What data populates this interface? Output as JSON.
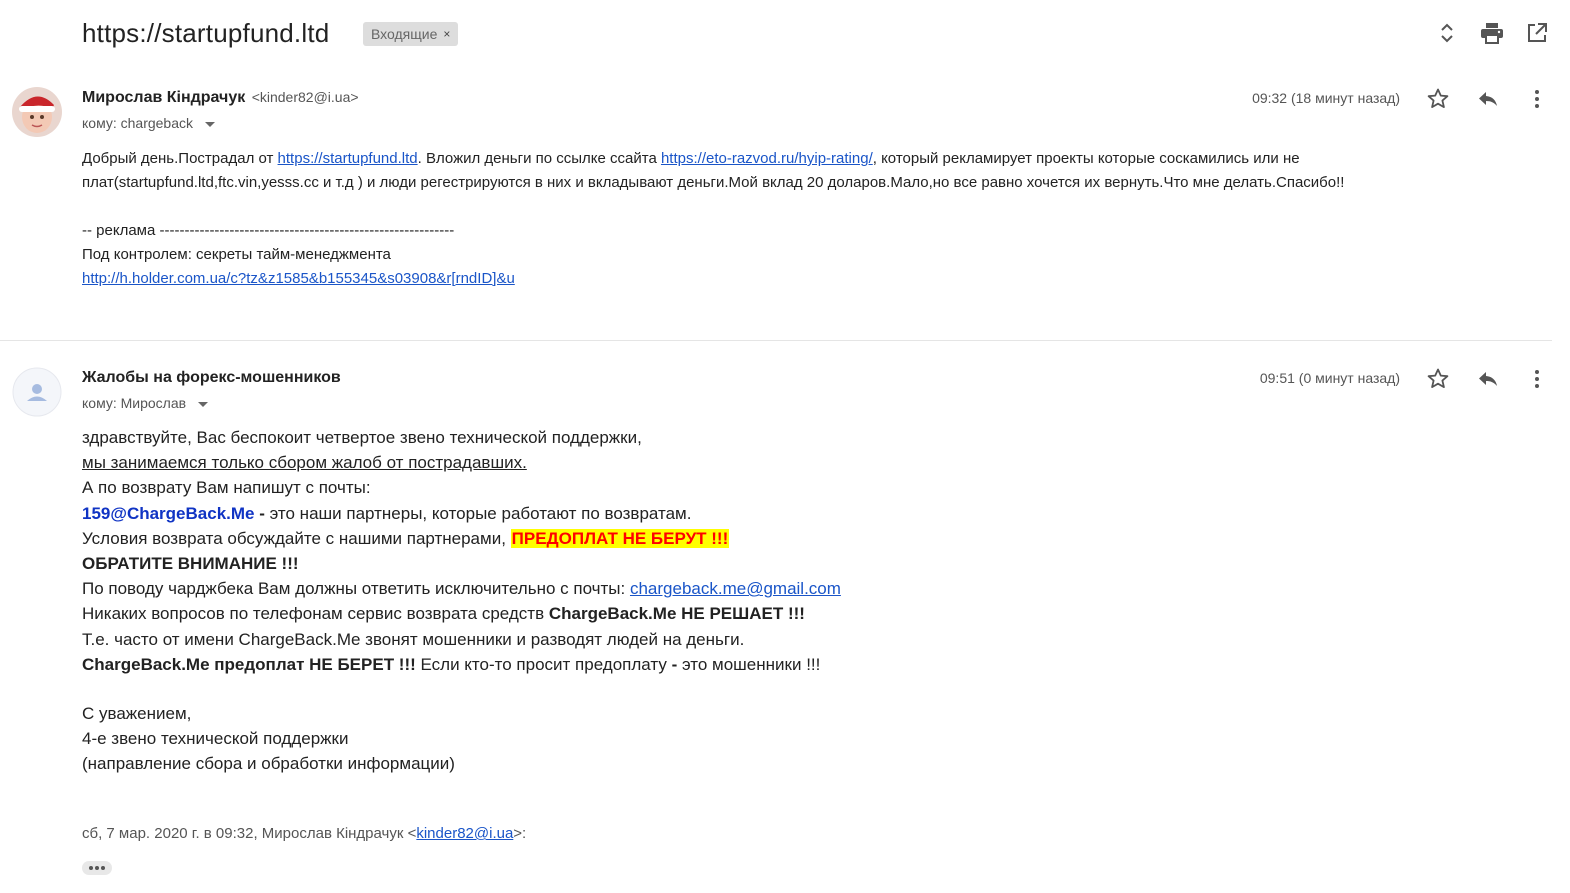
{
  "thread": {
    "subject": "https://startupfund.ltd",
    "label": "Входящие",
    "label_remove": "×"
  },
  "toolbar": {
    "expand_icon": "unfold-more-icon",
    "print_icon": "print-icon",
    "open_new_window_icon": "open-in-new-icon"
  },
  "messages": [
    {
      "sender_name": "Мирослав Кіндрачук",
      "sender_email": "<kinder82@i.ua>",
      "recipient": "кому: chargeback",
      "time": "09:32 (18 минут назад)",
      "body": {
        "p1_a": "Добрый день.Пострадал от ",
        "p1_link1": "https://startupfund.ltd",
        "p1_b": ". Вложил деньги по ссылке ссайта ",
        "p1_link2": "https://eto-razvod.ru/hyip-rating/",
        "p1_c": ", который рекламирует проекты которые соскамились или не",
        "p2": "плат(startupfund.ltd,ftc.vin,yesss.cc и т.д ) и люди регестрируются в них и вкладывают деньги.Мой вклад 20 доларов.Мало,но все равно хочется их вернуть.Что мне делать.Спасибо!!",
        "ad_line": "-- реклама -----------------------------------------------------------",
        "ad_title": "Под контролем: секреты тайм-менеджмента",
        "ad_link": "http://h.holder.com.ua/c?tz&z1585&b155345&s03908&r[rndID]&u"
      }
    },
    {
      "sender_name": "Жалобы на форекс-мошенников",
      "recipient": "кому: Мирослав",
      "time": "09:51 (0 минут назад)",
      "body": {
        "l1": "здравствуйте, Вас беспокоит четвертое звено технической поддержки,",
        "l2": "мы занимаемся только сбором жалоб от пострадавших.",
        "l3": "А по возврату Вам напишут с почты:",
        "l4_email": "159@ChargeBack.Me",
        "l4_dash": " - ",
        "l4_text": "это наши партнеры, которые работают по возвратам.",
        "l5_text": "Условия возврата обсуждайте с нашими партнерами, ",
        "l5_highlight": "ПРЕДОПЛАТ НЕ БЕРУТ !!!",
        "l6": "ОБРАТИТЕ ВНИМАНИЕ !!!",
        "l7_text": "По поводу чарджбека Вам должны ответить исключительно с почты: ",
        "l7_link": "chargeback.me@gmail.com",
        "l8_text": "Никаких вопросов по телефонам сервис возврата средств ",
        "l8_bold": "ChargeBack.Me НЕ РЕШАЕТ !!!",
        "l9": "Т.е. часто от имени ChargeBack.Me звонят мошенники и разводят людей на деньги.",
        "l10_bold": "ChargeBack.Me предоплат НЕ БЕРЕТ !!!",
        "l10_text": " Если кто-то просит предоплату ",
        "l10_dash": "-",
        "l10_tail": " это мошенники !!!",
        "sig1": "С уважением,",
        "sig2": "4-е звено технической поддержки",
        "sig3": "(направление сбора и обработки информации)"
      },
      "quote": {
        "prefix": "сб, 7 мар. 2020 г. в 09:32, Мирослав Кіндрачук <",
        "email": "kinder82@i.ua",
        "suffix": ">:"
      }
    }
  ],
  "colors": {
    "link": "#1a55c8",
    "highlight_bg": "#ffff00",
    "highlight_text": "#ff0000",
    "partner_email": "#1034c4"
  }
}
